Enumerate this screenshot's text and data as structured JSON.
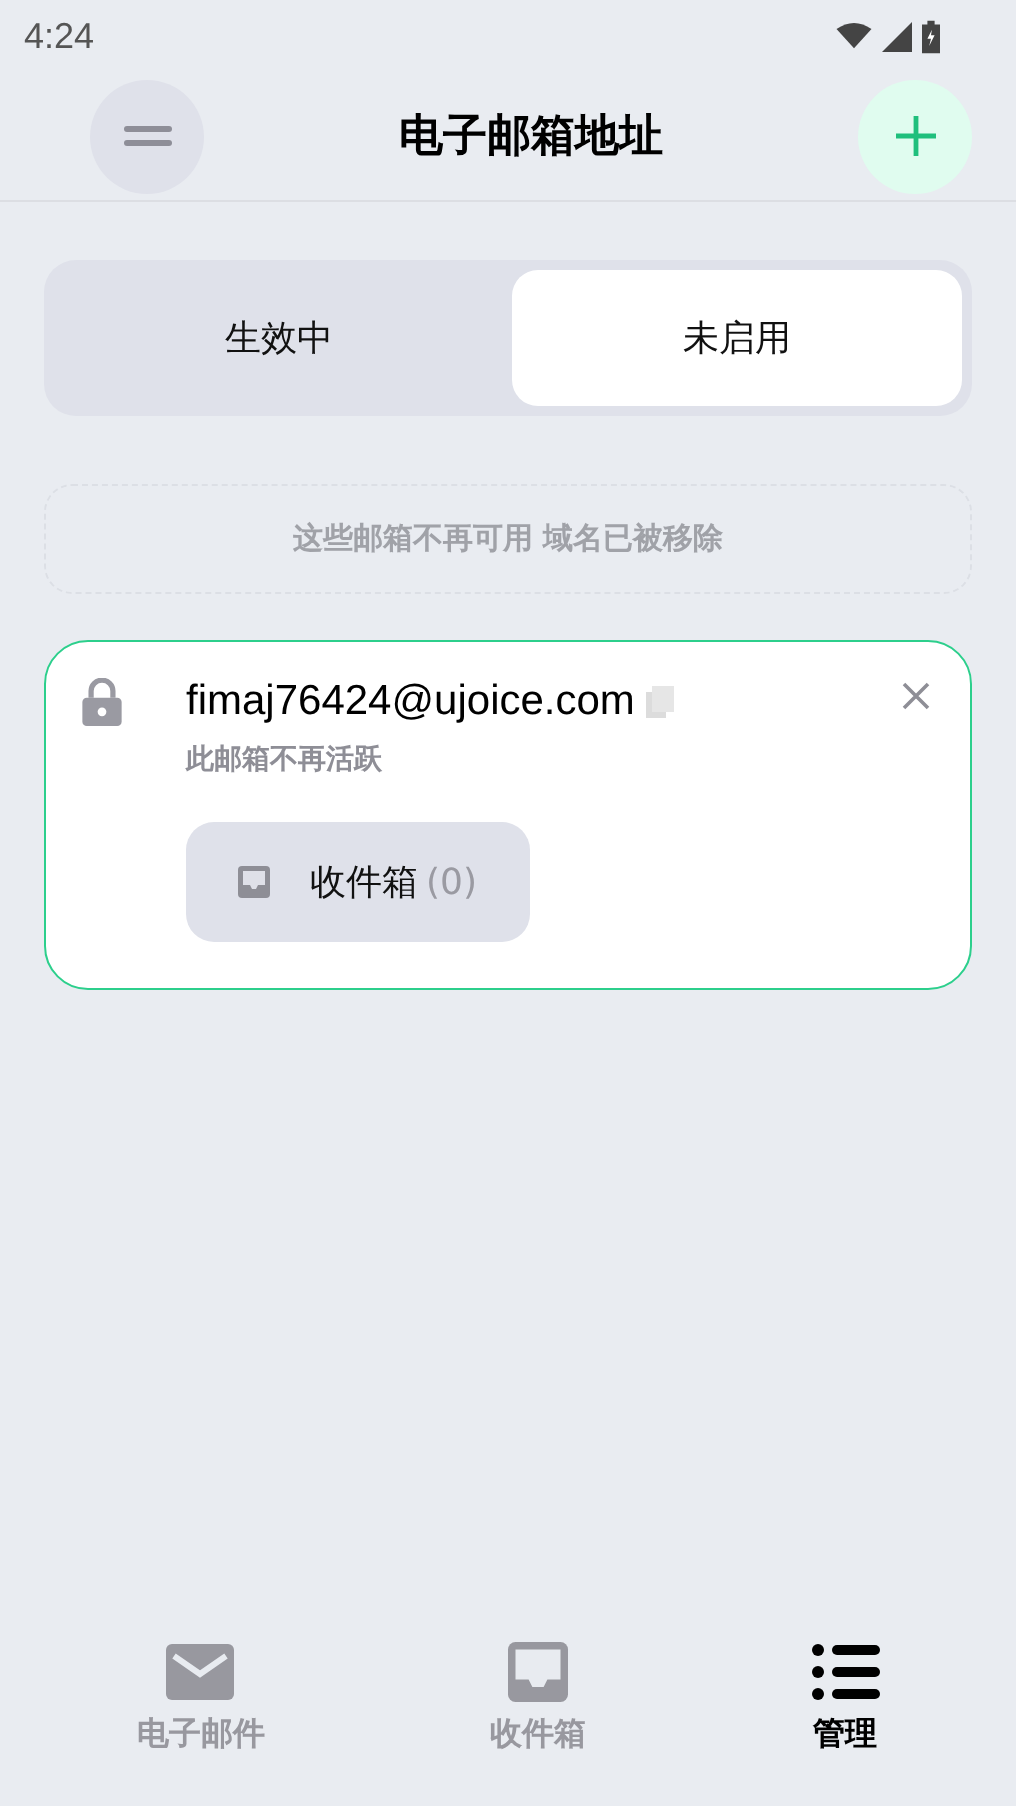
{
  "status_bar": {
    "time": "4:24"
  },
  "header": {
    "title": "电子邮箱地址"
  },
  "segments": [
    {
      "label": "生效中",
      "selected": false
    },
    {
      "label": "未启用",
      "selected": true
    }
  ],
  "notice": "这些邮箱不再可用 域名已被移除",
  "addresses": [
    {
      "address": "fimaj76424@ujoice.com",
      "status": "此邮箱不再活跃",
      "locked": true,
      "inbox_label": "收件箱",
      "inbox_count": "(0)"
    }
  ],
  "bottom_nav": [
    {
      "kind": "mail",
      "label": "电子邮件",
      "selected": false
    },
    {
      "kind": "inbox",
      "label": "收件箱",
      "selected": false
    },
    {
      "kind": "list",
      "label": "管理",
      "selected": true
    }
  ]
}
